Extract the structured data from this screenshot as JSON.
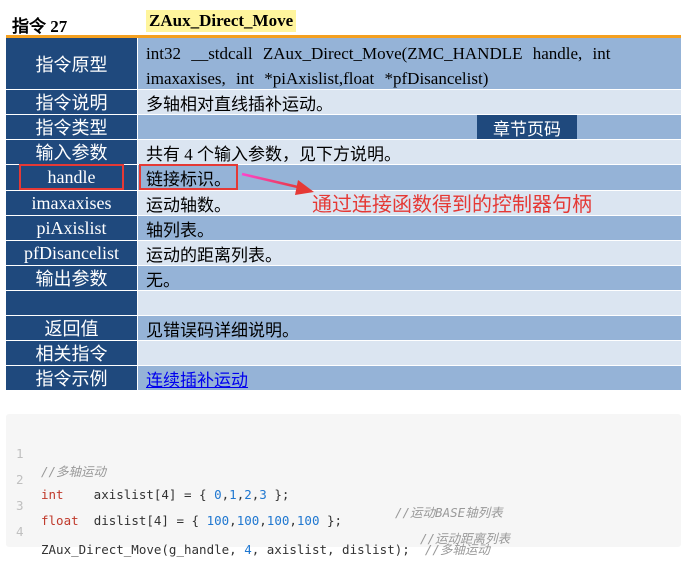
{
  "header": {
    "label": "指令 27",
    "function_name": "ZAux_Direct_Move"
  },
  "rows": [
    {
      "label": "指令原型",
      "value_line1": "int32 __stdcall ZAux_Direct_Move(ZMC_HANDLE handle, int",
      "value_line2": "imaxaxises, int *piAxislist,float *pfDisancelist)"
    },
    {
      "label": "指令说明",
      "value": "多轴相对直线插补运动。"
    },
    {
      "label": "指令类型",
      "value": "",
      "chapter": "章节页码"
    },
    {
      "label": "输入参数",
      "value": "共有 4 个输入参数，见下方说明。"
    },
    {
      "label": "handle",
      "value": "链接标识。"
    },
    {
      "label": "imaxaxises",
      "value": "运动轴数。"
    },
    {
      "label": "piAxislist",
      "value": "轴列表。"
    },
    {
      "label": "pfDisancelist",
      "value": "运动的距离列表。"
    },
    {
      "label": "输出参数",
      "value": "无。"
    },
    {
      "label": "",
      "value": ""
    },
    {
      "label": "返回值",
      "value": "见错误码详细说明。"
    },
    {
      "label": "相关指令",
      "value": ""
    },
    {
      "label": "指令示例",
      "value": "连续插补运动"
    }
  ],
  "annotation": "通过连接函数得到的控制器句柄",
  "code": {
    "line_numbers": [
      "1",
      "2",
      "3",
      "4"
    ],
    "l1_comment": "//多轴运动",
    "l2_kw": "int",
    "l2_a": "    axislist[4] = { ",
    "l2_n1": "0",
    "l2_n2": "1",
    "l2_n3": "2",
    "l2_n4": "3",
    "l2_b": " };",
    "l2_comment": "//运动BASE轴列表",
    "l3_kw": "float",
    "l3_a": "  dislist[4] = { ",
    "l3_n1": "100",
    "l3_n2": "100",
    "l3_n3": "100",
    "l3_n4": "100",
    "l3_b": " };",
    "l3_comment": "//运动距离列表",
    "l4_a": "ZAux_Direct_Move(g_handle, ",
    "l4_n": "4",
    "l4_b": ", axislist, dislist);",
    "l4_comment": "//多轴运动"
  },
  "colors": {
    "label_bg": "#1f497d",
    "value_bg": "#95b3d7",
    "value_bg_alt": "#dbe5f1",
    "accent": "#e53935"
  }
}
